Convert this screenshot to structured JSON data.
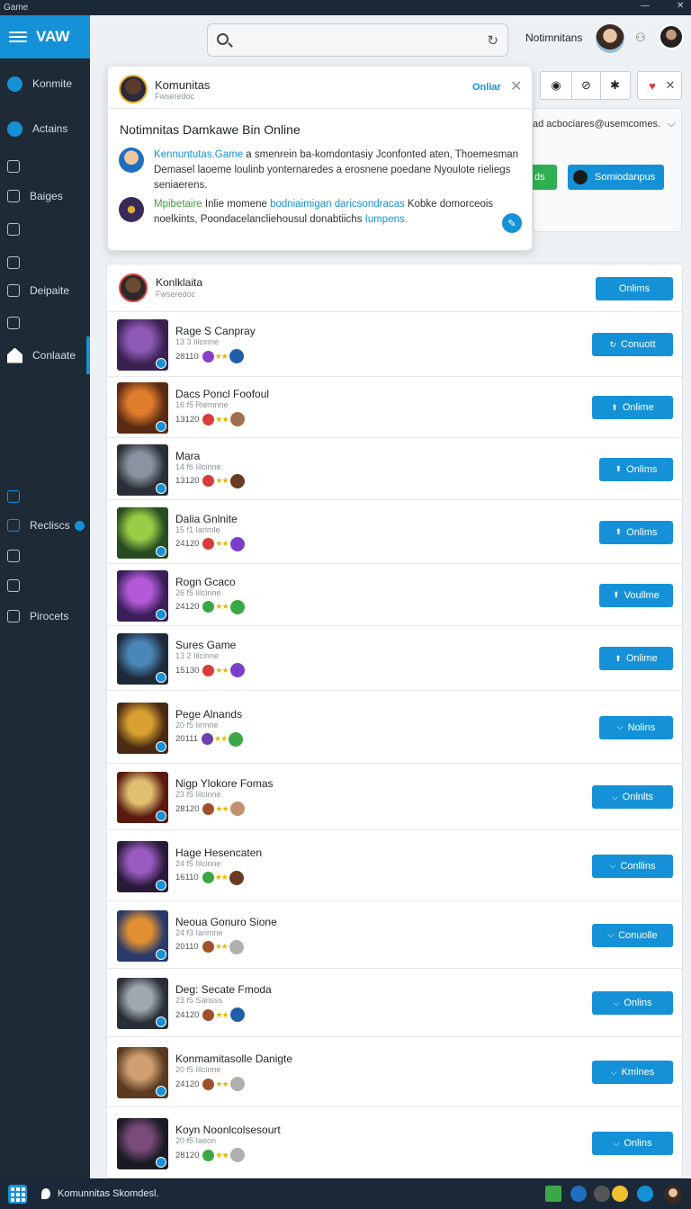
{
  "window": {
    "title": "Game",
    "minimize": "—",
    "close": "✕"
  },
  "sidebar": {
    "brand": "VAW",
    "items": [
      {
        "label": "Konmite",
        "icon": "compass-icon"
      },
      {
        "label": "Actains",
        "icon": "actions-icon"
      },
      {
        "label": "",
        "icon": "link-icon"
      },
      {
        "label": "Baiges",
        "icon": "home-icon"
      },
      {
        "label": "",
        "icon": "settings-icon"
      },
      {
        "label": "",
        "icon": "folder-icon"
      },
      {
        "label": "Deipaite",
        "icon": "square-icon"
      },
      {
        "label": "",
        "icon": "cards-icon"
      },
      {
        "label": "Conlaate",
        "icon": "house-icon"
      },
      {
        "label": "",
        "icon": "download-icon"
      },
      {
        "label": "Recliscs",
        "icon": "list-icon"
      },
      {
        "label": "",
        "icon": "mail-icon"
      },
      {
        "label": "",
        "icon": "cog-icon"
      },
      {
        "label": "Pirocets",
        "icon": "home-outline-icon"
      }
    ]
  },
  "topbar": {
    "search_placeholder": "",
    "user_name": "Notimnitans"
  },
  "notification": {
    "title": "Komunitas",
    "subtitle": "Fwseredoc",
    "status": "Onliar",
    "heading": "Notimnitas Damkawe Bin Online",
    "messages": [
      {
        "link": "Kennuntutas.Game",
        "text": " a smenrein ba-komdontasiy Jconfonted aten, Thoemesman Demasel laoeme loulinb yonternaredes a erosnene poedane Nyoulote rieliegs seniaerens."
      },
      {
        "link_green": "Mpibetaire",
        "text1": " Inlie momene ",
        "link": "bodniaimigan daricsondracas",
        "text2": " Kobke domorceois noelkints, Poondacelancliehousul donabtiichs ",
        "link2": "Iumpens."
      }
    ]
  },
  "controls": {
    "email": "ad acbociares@usemcomes.",
    "green_button": "ds",
    "blue_button": "Somiodanpus"
  },
  "list_header": {
    "title": "Konlklaita",
    "subtitle": "Fwseredoc",
    "button": "Onlims"
  },
  "games": [
    {
      "title": "Rage S Canpray",
      "sub": "13 3  Iilcinne",
      "meta": "28110",
      "button": "Conuott",
      "btn_icon": "↻",
      "c1": "#8a3fc9",
      "c2": "#1f5fa8",
      "thumb": [
        "#3a2150",
        "#8e5ab6"
      ]
    },
    {
      "title": "Dacs Poncl Foofoul",
      "sub": "16 f5  Riemnne",
      "meta": "13120",
      "button": "Onlime",
      "btn_icon": "⬆",
      "c1": "#d93c3c",
      "c2": "#a0704e",
      "thumb": [
        "#5a2a12",
        "#e07d2c"
      ]
    },
    {
      "title": "Mara",
      "sub": "14 f6  Iilcinne",
      "meta": "13120",
      "button": "Onlims",
      "btn_icon": "⬆",
      "c1": "#d93c3c",
      "c2": "#6a3a22",
      "thumb": [
        "#2a2e36",
        "#8a94a0"
      ]
    },
    {
      "title": "Dalia Gnlnite",
      "sub": "15 f1  Iarimle",
      "meta": "24120",
      "button": "Onlims",
      "btn_icon": "⬆",
      "c1": "#d93c3c",
      "c2": "#7a3fc9",
      "thumb": [
        "#274b22",
        "#9bcc45"
      ]
    },
    {
      "title": "Rogn Gcaco",
      "sub": "26 f5  Iilcinne",
      "meta": "24120",
      "button": "Voullme",
      "btn_icon": "⬆",
      "c1": "#3aa844",
      "c2": "#3aa844",
      "thumb": [
        "#3a1f5a",
        "#b45ad8"
      ]
    },
    {
      "title": "Sures Game",
      "sub": "13 2  Iilcinne",
      "meta": "15130",
      "button": "Onlime",
      "btn_icon": "⬆",
      "c1": "#d93c3c",
      "c2": "#7a3fc9",
      "thumb": [
        "#1e2a3a",
        "#4a86b8"
      ]
    },
    {
      "title": "Pege Alnands",
      "sub": "20 f5  Iirmne",
      "meta": "20111",
      "button": "Nolins",
      "btn_icon": "⌵",
      "c1": "#6a3fb0",
      "c2": "#3aa844",
      "thumb": [
        "#4a2a12",
        "#d8a030"
      ]
    },
    {
      "title": "Nigp Ylokore Fomas",
      "sub": "23 f5  Iilcinne",
      "meta": "28120",
      "button": "Onlnlts",
      "btn_icon": "⌵",
      "c1": "#a0502a",
      "c2": "#c09070",
      "thumb": [
        "#5a1a10",
        "#e0c070"
      ]
    },
    {
      "title": "Hage Hesencaten",
      "sub": "24 f5  Iilcinne",
      "meta": "16110",
      "button": "Conllins",
      "btn_icon": "⌵",
      "c1": "#3aa844",
      "c2": "#6a3a22",
      "thumb": [
        "#2a1a3a",
        "#9a5ac0"
      ]
    },
    {
      "title": "Neoua Gonuro Sione",
      "sub": "24 f3  Iarimne",
      "meta": "20110",
      "button": "Conuolle",
      "btn_icon": "⌵",
      "c1": "#a0502a",
      "c2": "#b0b0b0",
      "thumb": [
        "#2a3a6a",
        "#e09030"
      ]
    },
    {
      "title": "Deg: Secate Fmoda",
      "sub": "23 f5  Sarisss",
      "meta": "24120",
      "button": "Onlins",
      "btn_icon": "⌵",
      "c1": "#a0502a",
      "c2": "#1f5fa8",
      "thumb": [
        "#2a2e36",
        "#a0a8b0"
      ]
    },
    {
      "title": "Konmamitasolle Danigte",
      "sub": "20 f5  Iilcinne",
      "meta": "24120",
      "button": "Kmlnes",
      "btn_icon": "⌵",
      "c1": "#a0502a",
      "c2": "#b0b0b0",
      "thumb": [
        "#5a3a20",
        "#d0a070"
      ]
    },
    {
      "title": "Koyn Noonlcolsesourt",
      "sub": "20 f5  Iaeon",
      "meta": "28120",
      "button": "Onlins",
      "btn_icon": "⌵",
      "c1": "#3aa844",
      "c2": "#b0b0b0",
      "thumb": [
        "#1a1a24",
        "#7a4a7a"
      ]
    }
  ],
  "taskbar": {
    "app_label": "Komunnitas Skomdesl."
  }
}
